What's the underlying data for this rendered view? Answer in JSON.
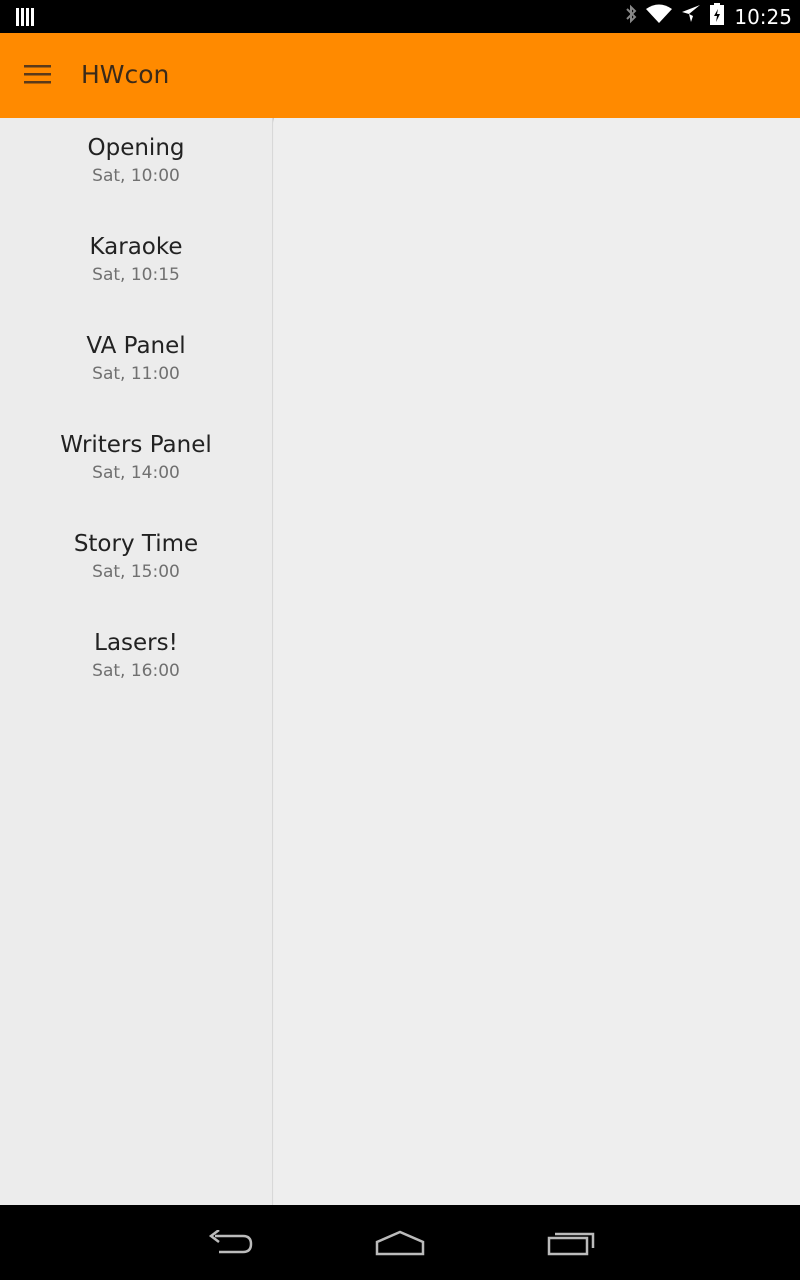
{
  "status_bar": {
    "time": "10:25",
    "icons": [
      "notification-icon",
      "bluetooth-icon",
      "wifi-icon",
      "airplane-mode-icon",
      "battery-icon"
    ]
  },
  "app_bar": {
    "title": "HWcon",
    "menu_icon": "menu-icon"
  },
  "events": [
    {
      "title": "Opening",
      "time": "Sat, 10:00"
    },
    {
      "title": "Karaoke",
      "time": "Sat, 10:15"
    },
    {
      "title": "VA Panel",
      "time": "Sat, 11:00"
    },
    {
      "title": "Writers Panel",
      "time": "Sat, 14:00"
    },
    {
      "title": "Story Time",
      "time": "Sat, 15:00"
    },
    {
      "title": "Lasers!",
      "time": "Sat, 16:00"
    }
  ],
  "nav_bar": {
    "buttons": [
      "back-icon",
      "home-icon",
      "recents-icon"
    ]
  },
  "colors": {
    "app_bar": "#ff8a00",
    "background": "#ececec",
    "title_text": "#222222",
    "subtitle_text": "#707070"
  }
}
